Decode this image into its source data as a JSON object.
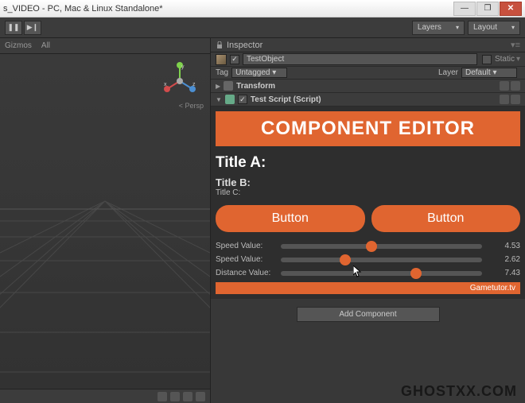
{
  "window_title": "s_VIDEO - PC, Mac & Linux Standalone*",
  "toolbar": {
    "layers": "Layers",
    "layout": "Layout"
  },
  "scene": {
    "gizmos_label": "Gizmos",
    "search_placeholder": "All",
    "persp_label": "< Persp",
    "axis": {
      "x": "x",
      "y": "y",
      "z": "z"
    }
  },
  "inspector": {
    "tab_label": "Inspector",
    "object_name": "TestObject",
    "static_label": "Static",
    "tag_label": "Tag",
    "tag_value": "Untagged",
    "layer_label": "Layer",
    "layer_value": "Default",
    "components": {
      "transform": "Transform",
      "script": "Test Script (Script)"
    }
  },
  "custom": {
    "banner": "COMPONENT EDITOR",
    "title_a": "Title A:",
    "title_b": "Title B:",
    "title_c": "Title C:",
    "button1": "Button",
    "button2": "Button",
    "sliders": [
      {
        "label": "Speed Value:",
        "value": "4.53",
        "pct": 45
      },
      {
        "label": "Speed Value:",
        "value": "2.62",
        "pct": 32
      },
      {
        "label": "Distance Value:",
        "value": "7.43",
        "pct": 67
      }
    ],
    "brand": "Gametutor.tv"
  },
  "add_component": "Add Component",
  "watermark": "GHOSTXX.COM",
  "colors": {
    "accent": "#e06530"
  }
}
